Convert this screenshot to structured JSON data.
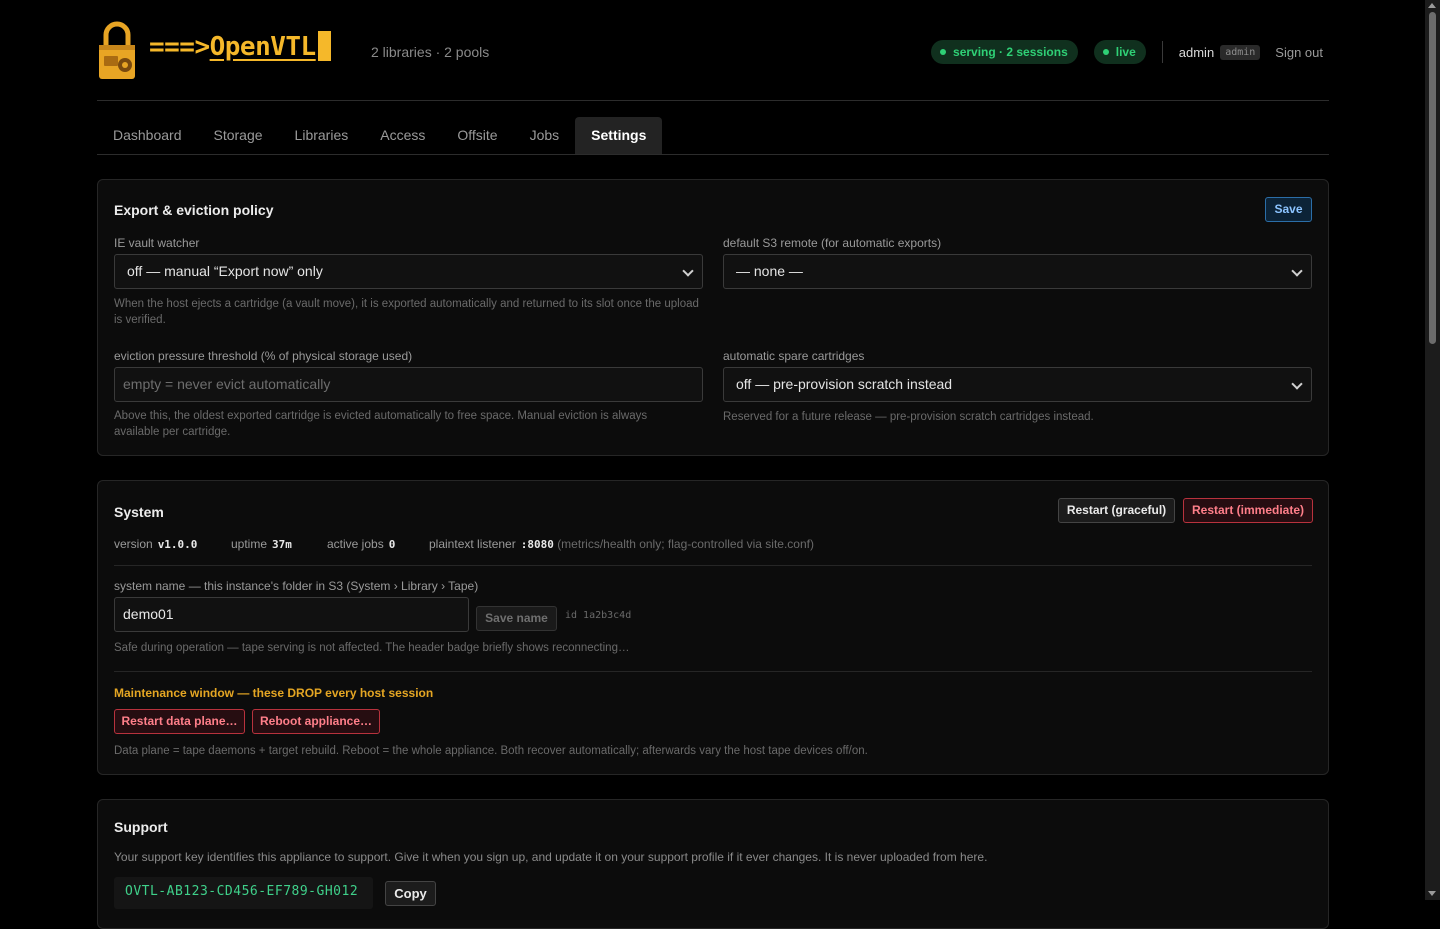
{
  "header": {
    "brand_arrow": "===>",
    "brand_name": "OpenVTL",
    "subtitle": "2 libraries · 2 pools",
    "status_pill": "serving · 2 sessions",
    "live_pill": "live",
    "user": "admin",
    "role": "admin",
    "signout": "Sign out"
  },
  "tabs": [
    "Dashboard",
    "Storage",
    "Libraries",
    "Access",
    "Offsite",
    "Jobs",
    "Settings"
  ],
  "active_tab": "Settings",
  "export": {
    "title": "Export & eviction policy",
    "save": "Save",
    "vault_label": "IE vault watcher",
    "vault_value": "off — manual “Export now” only",
    "vault_help": "When the host ejects a cartridge (a vault move), it is exported automatically and returned to its slot once the upload is verified.",
    "s3_label": "default S3 remote (for automatic exports)",
    "s3_value": "— none —",
    "evict_label": "eviction pressure threshold (% of physical storage used)",
    "evict_placeholder": "empty = never evict automatically",
    "evict_help": "Above this, the oldest exported cartridge is evicted automatically to free space. Manual eviction is always available per cartridge.",
    "spare_label": "automatic spare cartridges",
    "spare_value": "off — pre-provision scratch instead",
    "spare_help": "Reserved for a future release — pre-provision scratch cartridges instead."
  },
  "system": {
    "title": "System",
    "restart_graceful": "Restart (graceful)",
    "restart_immediate": "Restart (immediate)",
    "version_label": "version",
    "version": "v1.0.0",
    "uptime_label": "uptime",
    "uptime": "37m",
    "jobs_label": "active jobs",
    "jobs": "0",
    "listener_label": "plaintext listener",
    "listener": ":8080",
    "listener_note": "(metrics/health only; flag-controlled via site.conf)",
    "name_label": "system name — this instance's folder in S3 (System › Library › Tape)",
    "name_value": "demo01",
    "save_name": "Save name",
    "id_text": "id 1a2b3c4d",
    "name_help": "Safe during operation — tape serving is not affected. The header badge briefly shows reconnecting…",
    "maint_title": "Maintenance window — these DROP every host session",
    "restart_dp": "Restart data plane…",
    "reboot": "Reboot appliance…",
    "maint_help": "Data plane = tape daemons + target rebuild. Reboot = the whole appliance. Both recover automatically; afterwards vary the host tape devices off/on."
  },
  "support": {
    "title": "Support",
    "text": "Your support key identifies this appliance to support. Give it when you sign up, and update it on your support profile if it ever changes. It is never uploaded from here.",
    "key": "OVTL-AB123-CD456-EF789-GH012",
    "copy": "Copy"
  },
  "colors": {
    "accent": "#f5b82a",
    "ok": "#2fd076",
    "danger": "#ff7f8a",
    "warn": "#e5a623"
  }
}
